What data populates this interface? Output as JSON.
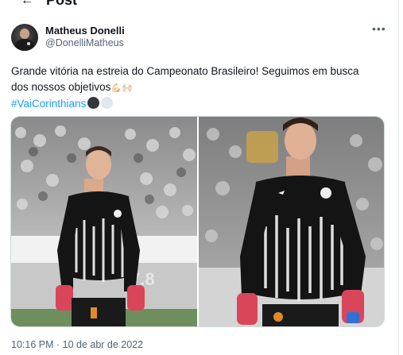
{
  "header": {
    "back_icon": "back-arrow-icon",
    "title": "Post"
  },
  "author": {
    "name": "Matheus Donelli",
    "handle": "@DonelliMatheus",
    "avatar": "avatar-photo"
  },
  "more_icon": "more-horizontal-icon",
  "tweet": {
    "line1": "Grande vitória na estreia do Campeonato Brasileiro! Seguimos em busca",
    "line2": "dos nossos objetivos",
    "emojis": "💪🏻🙌🏻",
    "hashtag": "#VaiCorinthians",
    "circle_emojis": [
      "black-circle",
      "white-circle"
    ]
  },
  "media": {
    "photos": [
      "goalkeeper-photo-left",
      "goalkeeper-photo-right"
    ]
  },
  "timestamp": "10:16 PM · 10 de abr de 2022",
  "colors": {
    "accent": "#1d9bf0",
    "text": "#0f1419",
    "muted": "#536471",
    "border": "#cfd9de"
  }
}
